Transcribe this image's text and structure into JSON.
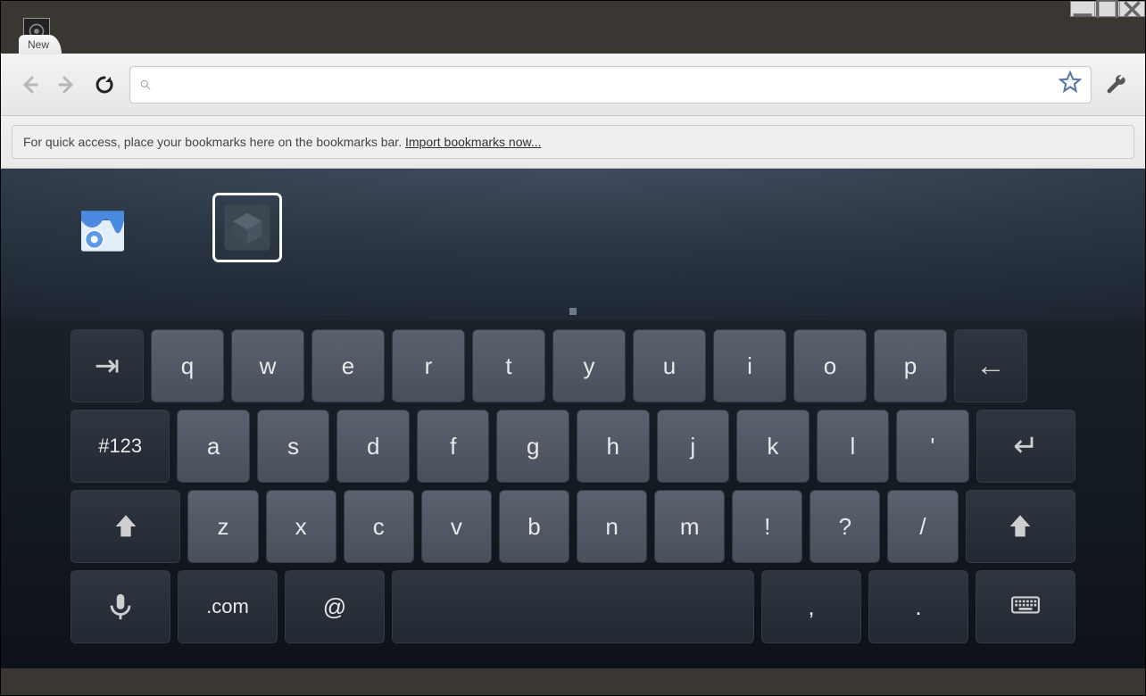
{
  "tab": {
    "title": "New"
  },
  "toolbar": {
    "url_value": "",
    "url_placeholder": ""
  },
  "bookmarks_hint": {
    "text": "For quick access, place your bookmarks here on the bookmarks bar.  ",
    "link": "Import bookmarks now..."
  },
  "ntp": {
    "apps": [
      {
        "id": "web-store",
        "icon": "store-icon"
      },
      {
        "id": "cube-app",
        "icon": "cube-icon",
        "selected": true
      }
    ]
  },
  "keyboard": {
    "row1": [
      "q",
      "w",
      "e",
      "r",
      "t",
      "y",
      "u",
      "i",
      "o",
      "p"
    ],
    "row2_label": "#123",
    "row2": [
      "a",
      "s",
      "d",
      "f",
      "g",
      "h",
      "j",
      "k",
      "l",
      "'"
    ],
    "row3": [
      "z",
      "x",
      "c",
      "v",
      "b",
      "n",
      "m",
      "!",
      "?",
      "/"
    ],
    "row4": {
      "com": ".com",
      "at": "@",
      "comma": ",",
      "period": "."
    }
  }
}
